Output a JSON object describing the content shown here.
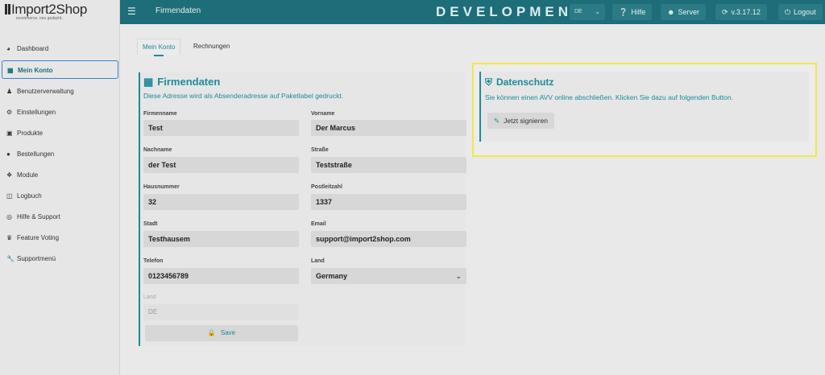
{
  "app": {
    "logo_text": "Import2Shop",
    "logo_tagline": "ecommerce. neu gedacht.",
    "page_title": "Firmendaten",
    "environment": "DEVELOPMENT",
    "language": "DE",
    "buttons": {
      "help": "Hilfe",
      "server": "Server",
      "version": "v.3.17.12",
      "logout": "Logout"
    },
    "icons": {
      "menu": "menu-icon",
      "help": "question-circle-icon",
      "server": "server-user-icon",
      "version": "refresh-icon",
      "logout": "power-icon"
    }
  },
  "sidebar": {
    "items": [
      {
        "label": "Dashboard",
        "icon": "dashboard-icon",
        "active": false
      },
      {
        "label": "Mein Konto",
        "icon": "building-icon",
        "active": true
      },
      {
        "label": "Benutzerverwaltung",
        "icon": "users-icon",
        "active": false
      },
      {
        "label": "Einstellungen",
        "icon": "cogs-icon",
        "active": false
      },
      {
        "label": "Produkte",
        "icon": "box-icon",
        "active": false
      },
      {
        "label": "Bestellungen",
        "icon": "shopping-basket-icon",
        "active": false
      },
      {
        "label": "Module",
        "icon": "puzzle-icon",
        "active": false
      },
      {
        "label": "Logbuch",
        "icon": "book-icon",
        "active": false
      },
      {
        "label": "Hilfe & Support",
        "icon": "life-ring-icon",
        "active": false
      },
      {
        "label": "Feature Voting",
        "icon": "trophy-icon",
        "active": false
      },
      {
        "label": "Supportmenü",
        "icon": "wrench-icon",
        "active": false
      }
    ]
  },
  "tabs": [
    {
      "label": "Mein Konto",
      "active": true
    },
    {
      "label": "Rechnungen",
      "active": false
    }
  ],
  "firmendaten": {
    "title": "Firmendaten",
    "subtitle": "Diese Adresse wird als Absenderadresse auf Paketlabel gedruckt.",
    "fields": {
      "firmenname": {
        "label": "Firmenname",
        "value": "Test"
      },
      "vorname": {
        "label": "Vorname",
        "value": "Der Marcus"
      },
      "nachname": {
        "label": "Nachname",
        "value": "der Test"
      },
      "strasse": {
        "label": "Straße",
        "value": "Teststraße"
      },
      "hausnummer": {
        "label": "Hausnummer",
        "value": "32"
      },
      "postleitzahl": {
        "label": "Postleitzahl",
        "value": "1337"
      },
      "stadt": {
        "label": "Stadt",
        "value": "Testhausem"
      },
      "email": {
        "label": "Email",
        "value": "support@import2shop.com"
      },
      "telefon": {
        "label": "Telefon",
        "value": "0123456789"
      },
      "land": {
        "label": "Land",
        "value": "Germany"
      },
      "land_code": {
        "label": "Land",
        "value": "DE"
      }
    },
    "save_label": "Save"
  },
  "datenschutz": {
    "title": "Datenschutz",
    "text": "Sie können einen AVV online abschließen. Klicken Sie dazu auf folgenden Button.",
    "button_label": "Jetzt signieren"
  },
  "colors": {
    "brand": "#1d6e78",
    "accent": "#1d8a99",
    "highlight": "#f1e84a",
    "active_border": "#3a7fd0"
  }
}
